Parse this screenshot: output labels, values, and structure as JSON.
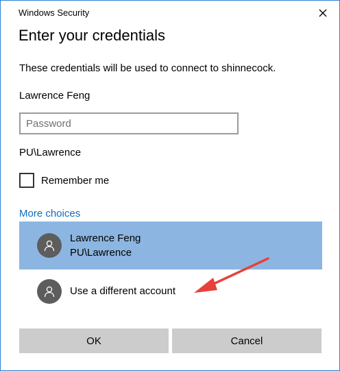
{
  "window": {
    "title": "Windows Security",
    "close_icon": "close-icon"
  },
  "dialog": {
    "heading": "Enter your credentials",
    "info": "These credentials will be used to connect to shinnecock.",
    "username": "Lawrence Feng",
    "password_placeholder": "Password",
    "password_value": "",
    "domain_user": "PU\\Lawrence",
    "remember_label": "Remember me",
    "remember_checked": false,
    "more_choices": "More choices"
  },
  "accounts": [
    {
      "name": "Lawrence Feng",
      "domain": "PU\\Lawrence",
      "selected": true,
      "icon": "user-avatar-icon"
    },
    {
      "name": "Use a different account",
      "selected": false,
      "icon": "user-avatar-icon"
    }
  ],
  "buttons": {
    "ok": "OK",
    "cancel": "Cancel"
  },
  "colors": {
    "border": "#2b7fd6",
    "selected_tile": "#8cb6e1",
    "link": "#0f6cbd",
    "button_bg": "#cccccc",
    "annotation_arrow": "#e8413a"
  }
}
